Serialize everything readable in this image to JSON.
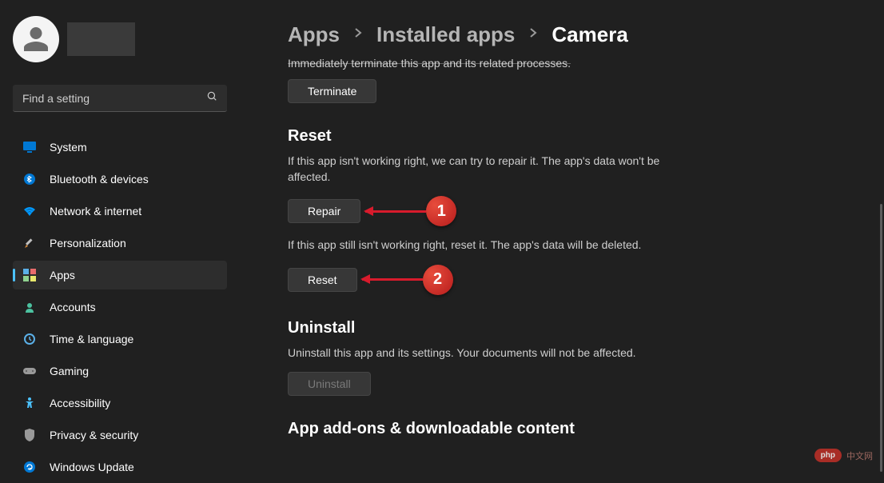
{
  "search": {
    "placeholder": "Find a setting"
  },
  "sidebar": {
    "items": [
      {
        "label": "System"
      },
      {
        "label": "Bluetooth & devices"
      },
      {
        "label": "Network & internet"
      },
      {
        "label": "Personalization"
      },
      {
        "label": "Apps"
      },
      {
        "label": "Accounts"
      },
      {
        "label": "Time & language"
      },
      {
        "label": "Gaming"
      },
      {
        "label": "Accessibility"
      },
      {
        "label": "Privacy & security"
      },
      {
        "label": "Windows Update"
      }
    ]
  },
  "breadcrumb": {
    "apps": "Apps",
    "installed": "Installed apps",
    "current": "Camera"
  },
  "terminate": {
    "partial_text": "Immediately terminate this app and its related processes.",
    "button": "Terminate"
  },
  "reset": {
    "title": "Reset",
    "desc1": "If this app isn't working right, we can try to repair it. The app's data won't be affected.",
    "repair_button": "Repair",
    "desc2": "If this app still isn't working right, reset it. The app's data will be deleted.",
    "reset_button": "Reset"
  },
  "uninstall": {
    "title": "Uninstall",
    "desc": "Uninstall this app and its settings. Your documents will not be affected.",
    "button": "Uninstall"
  },
  "addons": {
    "title": "App add-ons & downloadable content"
  },
  "annotations": {
    "one": "1",
    "two": "2"
  },
  "watermark": {
    "pill": "php",
    "text": "中文网"
  }
}
